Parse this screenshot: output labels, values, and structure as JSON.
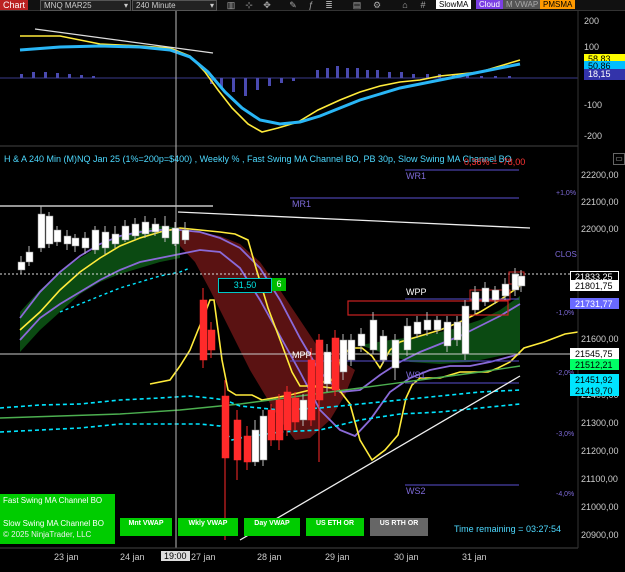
{
  "toolbar": {
    "chart_label": "Chart",
    "instrument": "MNQ MAR25",
    "interval": "240 Minute",
    "buttons": [
      {
        "label": "SlowMA",
        "bg": "#ffffff",
        "fg": "#000000"
      },
      {
        "label": "Cloud",
        "bg": "#7b3fe4",
        "fg": "#ffffff"
      },
      {
        "label": "M VWAP",
        "bg": "#555555",
        "fg": "#aaaaaa"
      },
      {
        "label": "PMSMA",
        "bg": "#ff9900",
        "fg": "#000000"
      }
    ]
  },
  "oscillator": {
    "axis": [
      "200",
      "100",
      "-100",
      "-200"
    ],
    "badges": [
      {
        "text": "58,83",
        "bg": "#ffff00",
        "fg": "#000"
      },
      {
        "text": "50,86",
        "bg": "#00bfff",
        "fg": "#000"
      },
      {
        "text": "18,15",
        "bg": "#3333aa",
        "fg": "#fff"
      }
    ]
  },
  "main": {
    "header": "H & A 240 Min (M)NQ Jan 25  (1%=200p=$400) , Weekly % , Fast Swing MA Channel BO, PB 30p, Slow Swing MA Channel BO",
    "pct_readout": "0,36% = -78,00",
    "level_labels": {
      "wr1": "WR1",
      "mr1": "MR1",
      "wpp": "WPP",
      "mpp": "MPP",
      "ws1": "WS1",
      "ws2": "WS2",
      "clos": "CLOS"
    },
    "pct_labels": [
      "+1,0%",
      "-1,0%",
      "-2,0%",
      "-3,0%",
      "-4,0%"
    ],
    "price_axis": [
      "22200,00",
      "22100,00",
      "22000,00",
      "21600,00",
      "21400,00",
      "21300,00",
      "21200,00",
      "21100,00",
      "21000,00",
      "20900,00"
    ],
    "price_badges": [
      {
        "text": "21833,25",
        "bg": "#000000",
        "fg": "#ffffff",
        "border": "#ffffff"
      },
      {
        "text": "21801,75",
        "bg": "#ffffff",
        "fg": "#000000",
        "border": "#ffffff"
      },
      {
        "text": "21731,77",
        "bg": "#6a6aff",
        "fg": "#ffffff",
        "border": "#6a6aff"
      },
      {
        "text": "21545,75",
        "bg": "#ffffff",
        "fg": "#000000",
        "border": "#ffffff"
      },
      {
        "text": "21512,21",
        "bg": "#00ff66",
        "fg": "#000000",
        "border": "#00ff66"
      },
      {
        "text": "21451,92",
        "bg": "#00e5ff",
        "fg": "#000000",
        "border": "#00e5ff"
      },
      {
        "text": "21419,70",
        "bg": "#00e5ff",
        "fg": "#000000",
        "border": "#00e5ff"
      }
    ],
    "crosshair_value": "31,50",
    "crosshair_count": "6",
    "strategy_labels": {
      "fast": "Fast Swing MA Channel BO",
      "slow": "Slow Swing MA Channel BO",
      "copyright": "© 2025 NinjaTrader, LLC"
    },
    "vwap_buttons": [
      {
        "label": "Mnt VWAP",
        "style": "green"
      },
      {
        "label": "Wkly VWAP",
        "style": "green"
      },
      {
        "label": "Day VWAP",
        "style": "green"
      },
      {
        "label": "US ETH OR",
        "style": "green"
      },
      {
        "label": "US RTH OR",
        "style": "gray"
      }
    ],
    "time_remaining": "Time remaining = 03:27:54"
  },
  "x_axis": {
    "dates": [
      "23 jan",
      "24 jan",
      "27 jan",
      "28 jan",
      "29 jan",
      "30 jan",
      "31 jan"
    ],
    "cursor_label": "19:00"
  }
}
